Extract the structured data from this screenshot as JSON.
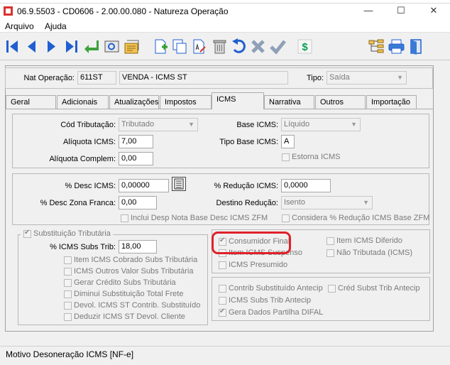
{
  "window": {
    "title": "06.9.5503 - CD0606 - 2.00.00.080 - Natureza Operação",
    "controls": {
      "minimize": "—",
      "maximize": "☐",
      "close": "✕"
    }
  },
  "menu": [
    {
      "label": "Arquivo"
    },
    {
      "label": "Ajuda"
    }
  ],
  "toolbar": {
    "left_buttons": [
      "first-record-icon",
      "prev-record-icon",
      "next-record-icon",
      "last-record-icon",
      "return-icon",
      "view-icon",
      "report-icon",
      "new-icon",
      "copy-icon",
      "edit-icon",
      "delete-icon",
      "undo-icon",
      "cancel-icon",
      "confirm-icon",
      "price-icon"
    ],
    "right_buttons": [
      "tree-icon",
      "print-icon",
      "exit-icon"
    ],
    "colors": {
      "nav": "#1f5fd0",
      "green": "#2f9e2f",
      "dollar": "#0aa050"
    }
  },
  "header": {
    "nat_label": "Nat Operação:",
    "nat_code": "611ST",
    "nat_desc": "VENDA - ICMS ST",
    "tipo_label": "Tipo:",
    "tipo_value": "Saída"
  },
  "tabs": [
    {
      "label": "Geral"
    },
    {
      "label": "Adicionais"
    },
    {
      "label": "Atualizações"
    },
    {
      "label": "Impostos"
    },
    {
      "label": "ICMS"
    },
    {
      "label": "Narrativa"
    },
    {
      "label": "Outros"
    },
    {
      "label": "Importação"
    }
  ],
  "icms": {
    "cod_trib_label": "Cód Tributação:",
    "cod_trib_value": "Tributado",
    "aliq_label": "Alíquota ICMS:",
    "aliq_value": "7,00",
    "aliq_compl_label": "Alíquota Complem:",
    "aliq_compl_value": "0,00",
    "base_label": "Base ICMS:",
    "base_value": "Líquido",
    "tipo_base_label": "Tipo Base ICMS:",
    "tipo_base_value": "A",
    "estorna_label": "Estorna ICMS"
  },
  "desconto": {
    "desc_label": "% Desc ICMS:",
    "desc_value": "0,00000",
    "desc_zf_label": "% Desc Zona Franca:",
    "desc_zf_value": "0,00",
    "reducao_label": "% Redução ICMS:",
    "reducao_value": "0,0000",
    "destino_label": "Destino Redução:",
    "destino_value": "Isento",
    "inclui_label": "Inclui Desp Nota Base Desc ICMS ZFM",
    "considera_label": "Considera % Redução ICMS Base ZFM"
  },
  "subst": {
    "title": "Substituição Tributária",
    "subs_trib_label": "% ICMS Subs Trib:",
    "subs_trib_value": "18,00",
    "checks": [
      "Item ICMS Cobrado Subs Tributária",
      "ICMS Outros Valor Subs Tributária",
      "Gerar Crédito Subs Tributária",
      "Diminui Substituição Total Frete",
      "Devol. ICMS ST Contrib. Substituído",
      "Deduzir ICMS ST Devol. Cliente"
    ]
  },
  "right_box1": {
    "consumidor": "Consumidor Final",
    "item_susp": "Item ICMS Suspenso",
    "presumido": "ICMS Presumido",
    "diferido": "Item ICMS Diferido",
    "nao_trib": "Não Tributada (ICMS)",
    "highlight_color": "#e0202a"
  },
  "right_box2": {
    "contrib": "Contrib Substituído Antecip",
    "cred": "Créd Subst Trib Antecip",
    "icms_subs": "ICMS Subs Trib Antecip",
    "difal": "Gera Dados Partilha DIFAL"
  },
  "status": "Motivo Desoneração ICMS [NF-e]"
}
